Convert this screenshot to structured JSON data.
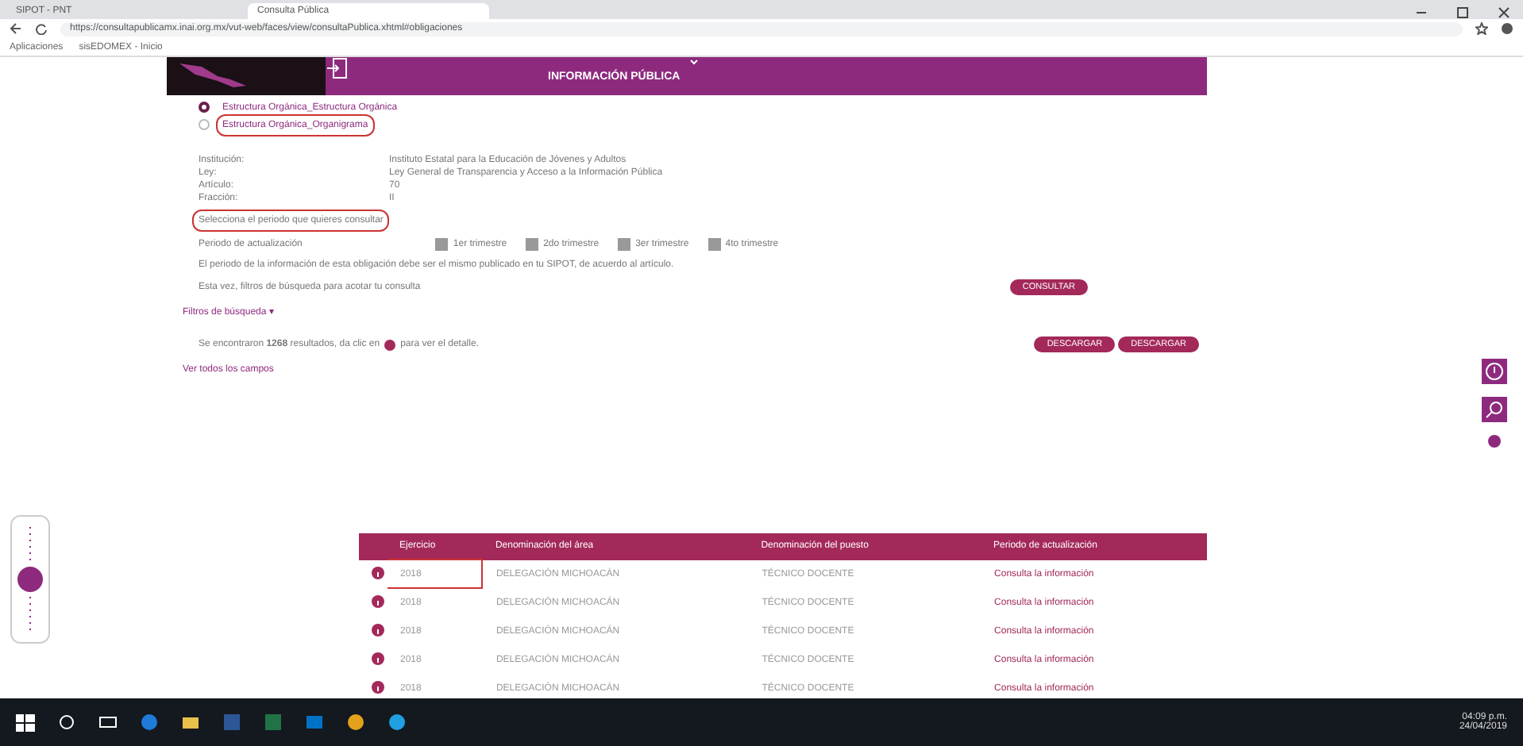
{
  "browser": {
    "tabs": [
      {
        "title": "SIPOT - PNT",
        "selected": false
      },
      {
        "title": "Consulta Pública",
        "selected": true
      }
    ],
    "url": "https://consultapublicamx.inai.org.mx/vut-web/faces/view/consultaPublica.xhtml#obligaciones",
    "bookmarks": [
      "Aplicaciones",
      "sisEDOMEX - Inicio"
    ]
  },
  "header": {
    "menu": "INFORMACIÓN PÚBLICA"
  },
  "formats": [
    {
      "label": "Estructura Orgánica_Estructura Orgánica",
      "selected": true,
      "highlighted": false
    },
    {
      "label": "Estructura Orgánica_Organigrama",
      "selected": false,
      "highlighted": true
    }
  ],
  "details": [
    {
      "label": "Institución:",
      "value": "Instituto Estatal para la Educación de Jóvenes y Adultos"
    },
    {
      "label": "Ley:",
      "value": "Ley General de Transparencia y Acceso a la Información Pública"
    },
    {
      "label": "Artículo:",
      "value": "70"
    },
    {
      "label": "Fracción:",
      "value": "II"
    }
  ],
  "period_prompt": {
    "text": "Selecciona el periodo que quieres consultar",
    "highlighted": true
  },
  "period": {
    "label": "Periodo de actualización",
    "options": [
      {
        "label": "1er trimestre",
        "checked": true
      },
      {
        "label": "2do trimestre",
        "checked": true
      },
      {
        "label": "3er trimestre",
        "checked": true
      },
      {
        "label": "4to trimestre",
        "checked": true
      }
    ]
  },
  "note": "El periodo de la información de esta obligación debe ser el mismo publicado en tu SIPOT, de acuerdo al artículo.",
  "filter_hint": "Esta vez, filtros de búsqueda para acotar tu consulta",
  "consult_button": "CONSULTAR",
  "filters_toggle": "Filtros de búsqueda ▾",
  "results": {
    "before": "Se encontraron **1268** resultados, da clic en",
    "after": "para ver el detalle."
  },
  "all_fields": "Ver todos los campos",
  "downloads": [
    "DESCARGAR",
    "DESCARGAR"
  ],
  "table": {
    "columns": [
      "Ejercicio",
      "Denominación del área",
      "Denominación del puesto",
      "Periodo de actualización"
    ],
    "rows": [
      {
        "cells": [
          "2018",
          "DELEGACIÓN MICHOACÁN",
          "TÉCNICO DOCENTE",
          "Consulta la información"
        ],
        "highlighted": true
      },
      {
        "cells": [
          "2018",
          "DELEGACIÓN MICHOACÁN",
          "TÉCNICO DOCENTE",
          "Consulta la información"
        ],
        "highlighted": false
      },
      {
        "cells": [
          "2018",
          "DELEGACIÓN MICHOACÁN",
          "TÉCNICO DOCENTE",
          "Consulta la información"
        ],
        "highlighted": false
      },
      {
        "cells": [
          "2018",
          "DELEGACIÓN MICHOACÁN",
          "TÉCNICO DOCENTE",
          "Consulta la información"
        ],
        "highlighted": false
      },
      {
        "cells": [
          "2018",
          "DELEGACIÓN MICHOACÁN",
          "TÉCNICO DOCENTE",
          "Consulta la información"
        ],
        "highlighted": false
      }
    ]
  },
  "taskbar": {
    "time": "04:09 p.m.",
    "date": "24/04/2019"
  }
}
